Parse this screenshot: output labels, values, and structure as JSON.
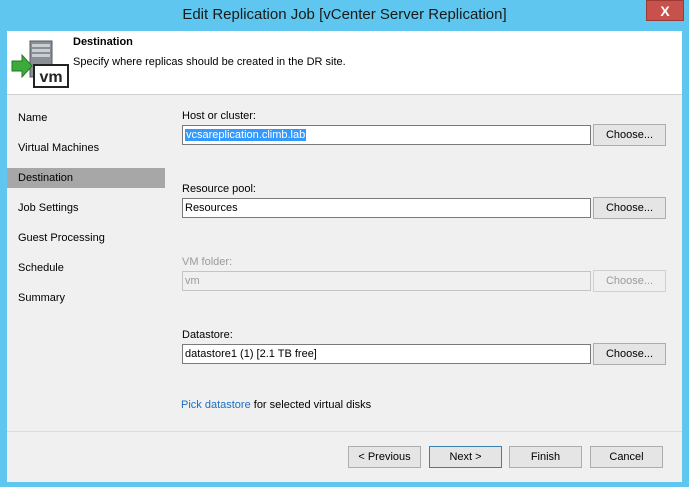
{
  "window": {
    "title": "Edit Replication Job [vCenter Server Replication]",
    "close_glyph": "X"
  },
  "header": {
    "title": "Destination",
    "subtitle": "Specify where replicas should be created in the DR site.",
    "icon": "server-vm-icon",
    "icon_text": "vm"
  },
  "nav": {
    "items": [
      {
        "label": "Name",
        "active": false
      },
      {
        "label": "Virtual Machines",
        "active": false
      },
      {
        "label": "Destination",
        "active": true
      },
      {
        "label": "Job Settings",
        "active": false
      },
      {
        "label": "Guest Processing",
        "active": false
      },
      {
        "label": "Schedule",
        "active": false
      },
      {
        "label": "Summary",
        "active": false
      }
    ]
  },
  "form": {
    "host": {
      "label": "Host or cluster:",
      "value": "vcsareplication.climb.lab",
      "button": "Choose..."
    },
    "pool": {
      "label": "Resource pool:",
      "value": "Resources",
      "button": "Choose..."
    },
    "folder": {
      "label": "VM folder:",
      "value": "vm",
      "button": "Choose...",
      "disabled": true
    },
    "datastore": {
      "label": "Datastore:",
      "value": "datastore1 (1) [2.1 TB free]",
      "button": "Choose..."
    },
    "pick_link": "Pick datastore",
    "pick_suffix": " for selected virtual disks"
  },
  "footer": {
    "previous": "< Previous",
    "next": "Next >",
    "finish": "Finish",
    "cancel": "Cancel"
  },
  "colors": {
    "titlebar": "#5fc7ef",
    "close": "#c7514b",
    "selection": "#3399ff",
    "nav_active": "#a7a7a7",
    "link": "#1a6fc4"
  }
}
